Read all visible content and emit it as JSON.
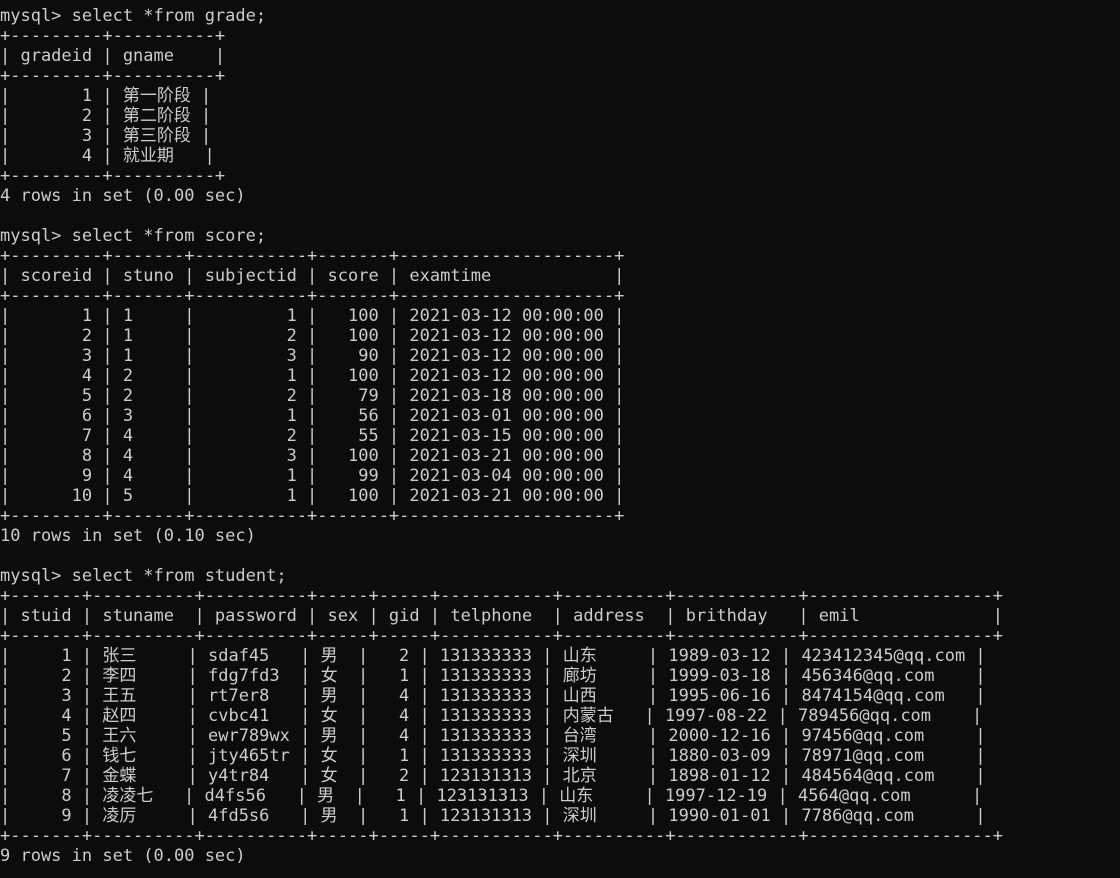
{
  "terminal": {
    "lines": [
      "mysql> select *from grade;",
      "+---------+----------+",
      "| gradeid | gname    |",
      "+---------+----------+",
      "|       1 | 第一阶段 |",
      "|       2 | 第二阶段 |",
      "|       3 | 第三阶段 |",
      "|       4 | 就业期   |",
      "+---------+----------+",
      "4 rows in set (0.00 sec)",
      "",
      "mysql> select *from score;",
      "+---------+-------+-----------+-------+---------------------+",
      "| scoreid | stuno | subjectid | score | examtime            |",
      "+---------+-------+-----------+-------+---------------------+",
      "|       1 | 1     |         1 |   100 | 2021-03-12 00:00:00 |",
      "|       2 | 1     |         2 |   100 | 2021-03-12 00:00:00 |",
      "|       3 | 1     |         3 |    90 | 2021-03-12 00:00:00 |",
      "|       4 | 2     |         1 |   100 | 2021-03-12 00:00:00 |",
      "|       5 | 2     |         2 |    79 | 2021-03-18 00:00:00 |",
      "|       6 | 3     |         1 |    56 | 2021-03-01 00:00:00 |",
      "|       7 | 4     |         2 |    55 | 2021-03-15 00:00:00 |",
      "|       8 | 4     |         3 |   100 | 2021-03-21 00:00:00 |",
      "|       9 | 4     |         1 |    99 | 2021-03-04 00:00:00 |",
      "|      10 | 5     |         1 |   100 | 2021-03-21 00:00:00 |",
      "+---------+-------+-----------+-------+---------------------+",
      "10 rows in set (0.10 sec)",
      "",
      "mysql> select *from student;",
      "+-------+----------+----------+-----+-----+-----------+----------+------------+------------------+",
      "| stuid | stuname  | password | sex | gid | telphone  | address  | brithday   | emil             |",
      "+-------+----------+----------+-----+-----+-----------+----------+------------+------------------+",
      "|     1 | 张三     | sdaf45   | 男  |   2 | 131333333 | 山东     | 1989-03-12 | 423412345@qq.com |",
      "|     2 | 李四     | fdg7fd3  | 女  |   1 | 131333333 | 廊坊     | 1999-03-18 | 456346@qq.com    |",
      "|     3 | 王五     | rt7er8   | 男  |   4 | 131333333 | 山西     | 1995-06-16 | 8474154@qq.com   |",
      "|     4 | 赵四     | cvbc41   | 女  |   4 | 131333333 | 内蒙古   | 1997-08-22 | 789456@qq.com    |",
      "|     5 | 王六     | ewr789wx | 男  |   4 | 131333333 | 台湾     | 2000-12-16 | 97456@qq.com     |",
      "|     6 | 钱七     | jty465tr | 女  |   1 | 131333333 | 深圳     | 1880-03-09 | 78971@qq.com     |",
      "|     7 | 金蝶     | y4tr84   | 女  |   2 | 123131313 | 北京     | 1898-01-12 | 484564@qq.com    |",
      "|     8 | 凌凌七   | d4fs56   | 男  |   1 | 123131313 | 山东     | 1997-12-19 | 4564@qq.com      |",
      "|     9 | 凌厉     | 4fd5s6   | 男  |   1 | 123131313 | 深圳     | 1990-01-01 | 7786@qq.com      |",
      "+-------+----------+----------+-----+-----+-----------+----------+------------+------------------+",
      "9 rows in set (0.00 sec)"
    ]
  }
}
